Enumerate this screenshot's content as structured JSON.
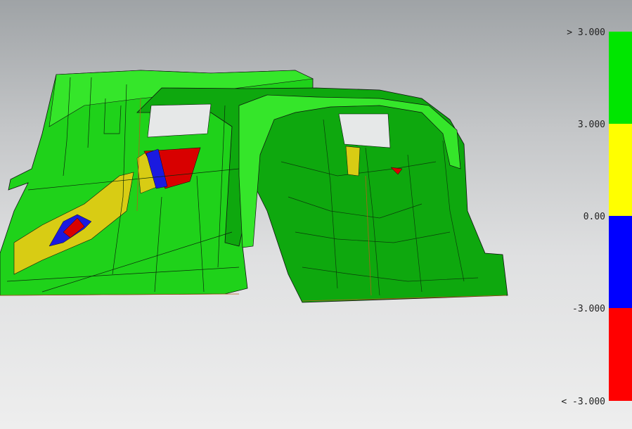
{
  "legend": {
    "labels": [
      "> 3.000",
      "3.000",
      "0.00",
      "-3.000",
      "< -3.000"
    ],
    "bands": [
      {
        "color": "#00e600",
        "name": "above-range"
      },
      {
        "color": "#ffff00",
        "name": "upper-tolerance"
      },
      {
        "color": "#0000ff",
        "name": "lower-tolerance"
      },
      {
        "color": "#ff0000",
        "name": "below-range"
      }
    ]
  },
  "colors": {
    "part_green": "#1fd21a",
    "part_green_light": "#35e62a",
    "part_green_dark": "#0ea80e",
    "deviation_yellow": "#d8cc14",
    "deviation_blue": "#1a1ae0",
    "deviation_red": "#d80000",
    "edge_orange": "#b0601a"
  }
}
